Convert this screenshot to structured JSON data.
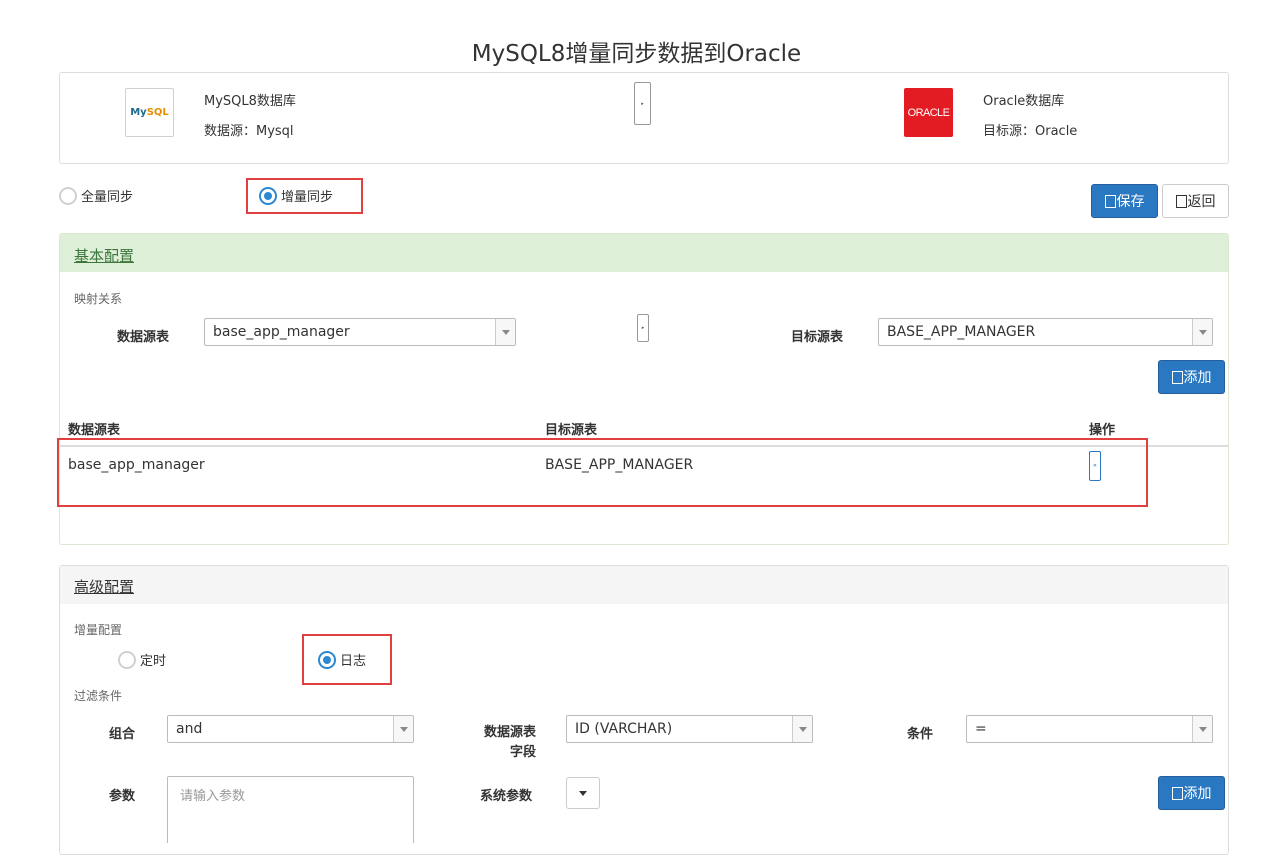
{
  "page_title": "MySQL8增量同步数据到Oracle",
  "source_db": {
    "logo_text_a": "My",
    "logo_text_b": "SQL",
    "name": "MySQL8数据库",
    "type_label": "数据源：Mysql"
  },
  "target_db": {
    "logo_text": "ORACLE",
    "name": "Oracle数据库",
    "type_label": "目标源：Oracle"
  },
  "sync_mode": {
    "full_label": "全量同步",
    "incremental_label": "增量同步",
    "selected": "incremental"
  },
  "toolbar": {
    "save_label": "保存",
    "back_label": "返回"
  },
  "basic_config": {
    "title": "基本配置",
    "mapping_label": "映射关系",
    "source_table_label": "数据源表",
    "source_table_value": "base_app_manager",
    "target_table_label": "目标源表",
    "target_table_value": "BASE_APP_MANAGER",
    "add_label": "添加",
    "table": {
      "headers": [
        "数据源表",
        "目标源表",
        "操作"
      ],
      "rows": [
        {
          "source": "base_app_manager",
          "target": "BASE_APP_MANAGER"
        }
      ]
    }
  },
  "advanced_config": {
    "title": "高级配置",
    "incremental_label": "增量配置",
    "timer_label": "定时",
    "log_label": "日志",
    "selected": "log",
    "filter_label": "过滤条件",
    "combine_label": "组合",
    "combine_value": "and",
    "field_label_line1": "数据源表",
    "field_label_line2": "字段",
    "field_value": "ID (VARCHAR)",
    "condition_label": "条件",
    "condition_value": "=",
    "param_label": "参数",
    "param_placeholder": "请输入参数",
    "sys_param_label": "系统参数",
    "add_label": "添加"
  },
  "colors": {
    "primary": "#2b78c2",
    "highlight": "#e04040",
    "green_header": "#dff0d8"
  }
}
